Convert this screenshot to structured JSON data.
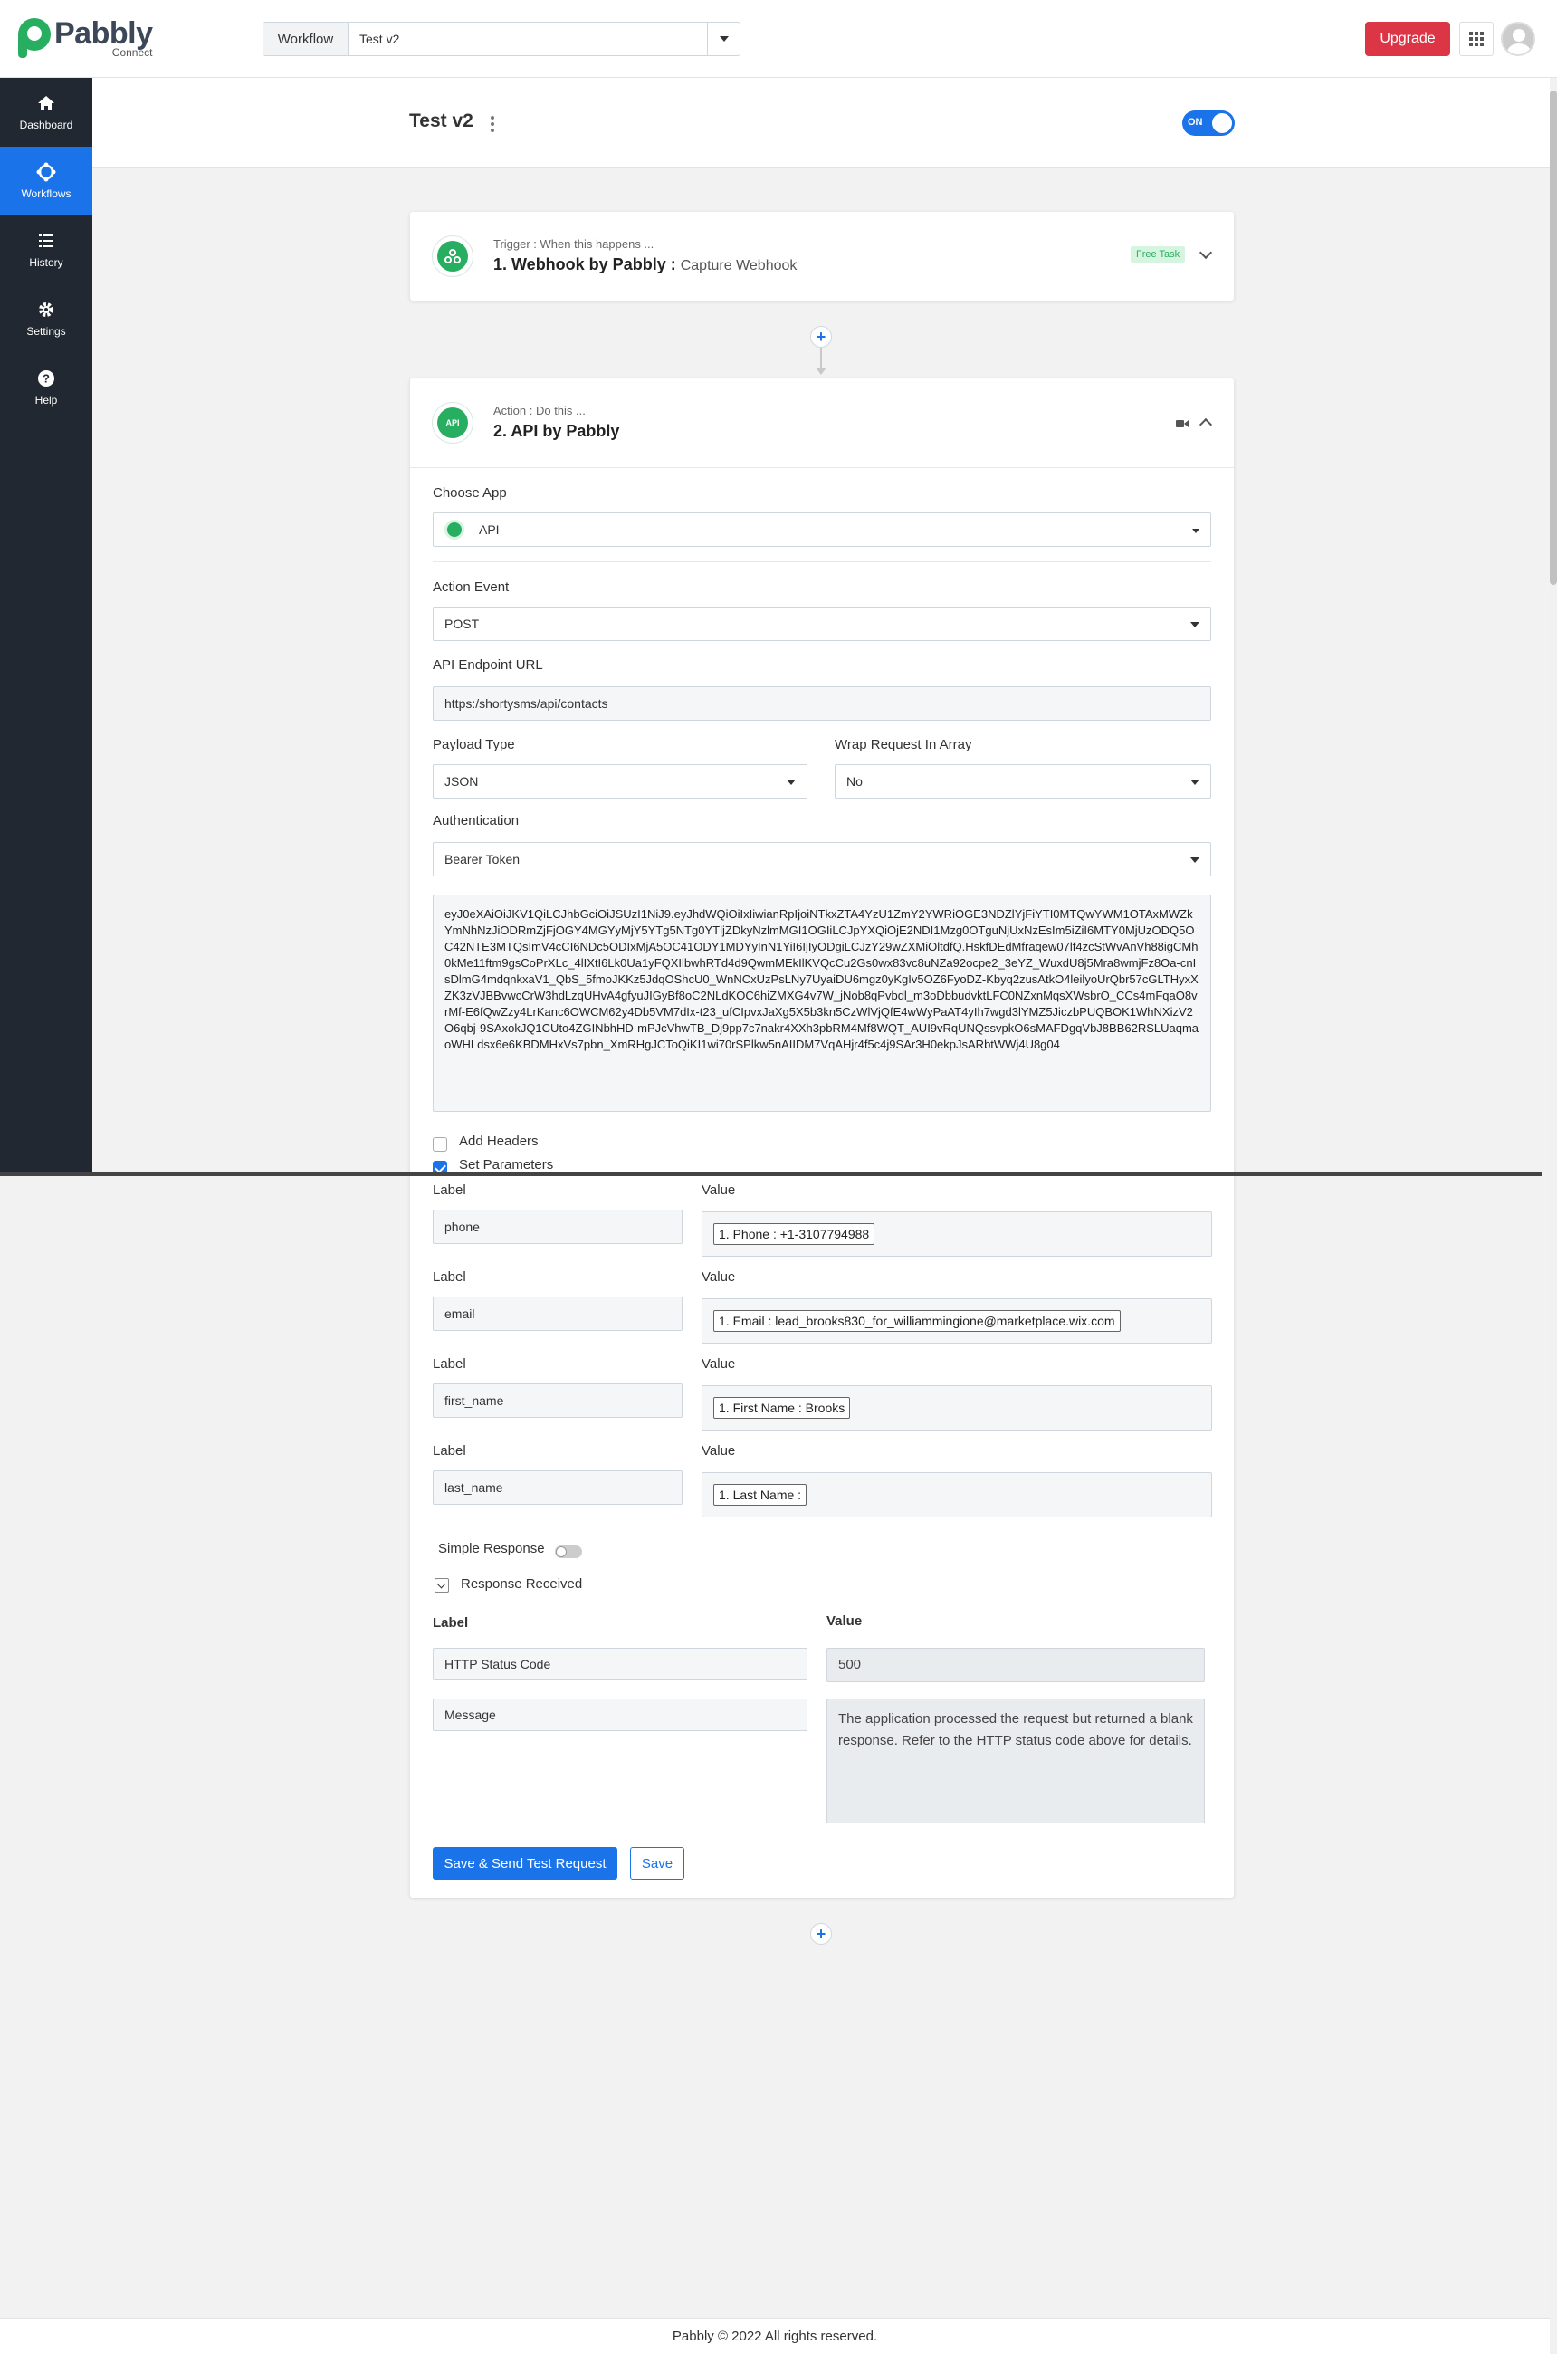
{
  "header": {
    "logo_text": "Pabbly",
    "logo_sub": "Connect",
    "workflow_label": "Workflow",
    "workflow_value": "Test v2",
    "upgrade_label": "Upgrade"
  },
  "sidebar": {
    "items": [
      {
        "label": "Dashboard",
        "icon": "home-icon",
        "active": false
      },
      {
        "label": "Workflows",
        "icon": "workflow-icon",
        "active": true
      },
      {
        "label": "History",
        "icon": "list-icon",
        "active": false
      },
      {
        "label": "Settings",
        "icon": "gear-icon",
        "active": false
      },
      {
        "label": "Help",
        "icon": "help-icon",
        "active": false
      }
    ]
  },
  "workflow": {
    "title": "Test v2",
    "toggle_label": "ON"
  },
  "trigger": {
    "kicker": "Trigger : When this happens ...",
    "title": "1. Webhook by Pabbly :",
    "subtitle": "Capture Webhook",
    "badge": "Free Task"
  },
  "action": {
    "kicker": "Action : Do this ...",
    "title": "2. API by Pabbly",
    "choose_app_label": "Choose App",
    "choose_app_value": "API",
    "action_event_label": "Action Event",
    "action_event_value": "POST",
    "endpoint_label": "API Endpoint URL",
    "endpoint_value": "https:/shortysms/api/contacts",
    "payload_type_label": "Payload Type",
    "payload_type_value": "JSON",
    "wrap_label": "Wrap Request In Array",
    "wrap_value": "No",
    "auth_label": "Authentication",
    "auth_value": "Bearer Token",
    "token": "eyJ0eXAiOiJKV1QiLCJhbGciOiJSUzI1NiJ9.eyJhdWQiOiIxIiwianRpIjoiNTkxZTA4YzU1ZmY2YWRiOGE3NDZlYjFiYTI0MTQwYWM1OTAxMWZkYmNhNzJiODRmZjFjOGY4MGYyMjY5YTg5NTg0YTljZDkyNzlmMGI1OGIiLCJpYXQiOjE2NDI1Mzg0OTguNjUxNzEsIm5iZiI6MTY0MjUzODQ5OC42NTE3MTQsImV4cCI6NDc5ODIxMjA5OC41ODY1MDYyInN1YiI6IjIyODgiLCJzY29wZXMiOltdfQ.HskfDEdMfraqew07lf4zcStWvAnVh88igCMh0kMe11ftm9gsCoPrXLc_4lIXtI6Lk0Ua1yFQXIlbwhRTd4d9QwmMEkIlKVQcCu2Gs0wx83vc8uNZa92ocpe2_3eYZ_WuxdU8j5Mra8wmjFz8Oa-cnIsDlmG4mdqnkxaV1_QbS_5fmoJKKz5JdqOShcU0_WnNCxUzPsLNy7UyaiDU6mgz0yKgIv5OZ6FyoDZ-Kbyq2zusAtkO4leilyoUrQbr57cGLTHyxXZK3zVJBBvwcCrW3hdLzqUHvA4gfyuJIGyBf8oC2NLdKOC6hiZMXG4v7W_jNob8qPvbdl_m3oDbbudvktLFC0NZxnMqsXWsbrO_CCs4mFqaO8vrMf-E6fQwZzy4LrKanc6OWCM62y4Db5VM7dIx-t23_ufCIpvxJaXg5X5b3kn5CzWlVjQfE4wWyPaAT4yIh7wgd3lYMZ5JiczbPUQBOK1WhNXizV2O6qbj-9SAxokJQ1CUto4ZGINbhHD-mPJcVhwTB_Dj9pp7c7nakr4XXh3pbRM4Mf8WQT_AUI9vRqUNQssvpkO6sMAFDgqVbJ8BB62RSLUaqmaoWHLdsx6e6KBDMHxVs7pbn_XmRHgJCToQiKI1wi70rSPlkw5nAIIDM7VqAHjr4f5c4j9SAr3H0ekpJsARbtWWj4U8g04",
    "add_headers_label": "Add Headers",
    "set_parameters_label": "Set Parameters",
    "label_header": "Label",
    "value_header": "Value",
    "params": [
      {
        "label": "phone",
        "value_pill": "1. Phone : +1-3107794988"
      },
      {
        "label": "email",
        "value_pill": "1. Email : lead_brooks830_for_williammingione@marketplace.wix.com"
      },
      {
        "label": "first_name",
        "value_pill": "1. First Name : Brooks"
      },
      {
        "label": "last_name",
        "value_pill": "1. Last Name :"
      }
    ],
    "simple_response_label": "Simple Response",
    "response_received_label": "Response Received",
    "resp_label_header": "Label",
    "resp_value_header": "Value",
    "status_code_label": "HTTP Status Code",
    "status_code_value": "500",
    "message_label": "Message",
    "message_value": "The application processed the request but returned a blank response.  Refer to the HTTP status code above for details.",
    "save_send_label": "Save & Send Test Request",
    "save_label": "Save"
  },
  "footer": {
    "text": "Pabbly © 2022 All rights reserved."
  }
}
